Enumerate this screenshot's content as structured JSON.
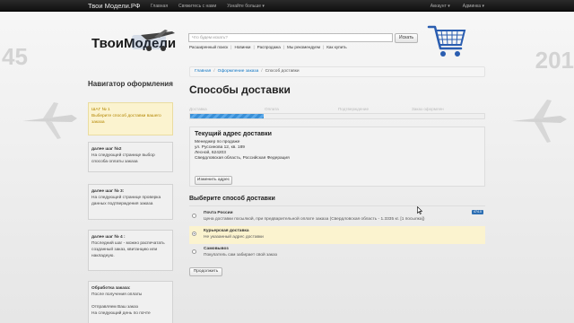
{
  "topbar": {
    "brand": "Твои Модели.РФ",
    "nav": [
      "Главная",
      "Свяжитесь с нами",
      "Узнайте больше ▾"
    ],
    "right": [
      "Аккаунт ▾",
      "Админка ▾"
    ]
  },
  "header": {
    "logo_text": "ТвоиМодели",
    "search_placeholder": "Что будем искать?",
    "search_button": "Искать",
    "quicklinks": [
      "Расширенный поиск",
      "Новинки",
      "Распродажа",
      "Мы рекомендуем",
      "Как купить"
    ]
  },
  "background": {
    "left_number": "45",
    "right_number": "201"
  },
  "sidebar": {
    "title": "Навигатор оформления",
    "steps": [
      {
        "head": "ШАГ № 1",
        "text": "Выберите способ доставки вашего заказа"
      },
      {
        "head": "далее шаг №2",
        "text": "На следующей странице выбор способа оплаты заказа"
      },
      {
        "head": "далее шаг № 3:",
        "text": "На следующей странице проверка данных подтверждения заказа"
      },
      {
        "head": "далее шаг № 4 :",
        "text": "Последний шаг - можно распечатать созданный заказ, квитанцию или накладную."
      },
      {
        "head": "Обработка заказа:",
        "text": "После получения оплаты",
        "text2": "Отправляем Ваш заказ",
        "text3": "На следующий день по почте"
      }
    ]
  },
  "breadcrumb": {
    "home": "Главная",
    "checkout": "Оформление заказа",
    "current": "Способ доставки"
  },
  "main": {
    "title": "Способы доставки",
    "progress": {
      "labels": [
        "Доставка",
        "Оплата",
        "Подтверждение",
        "Заказ оформлен"
      ],
      "fraction": 0.25
    },
    "address": {
      "title": "Текущий адрес доставки",
      "lines": [
        "Менеджер по продаже",
        "ул. Руссинова 12, кв. 189",
        "Лесной, 624203",
        "Свердловская область, Российская Федерация"
      ],
      "button": "Изменить адрес"
    },
    "shipping": {
      "title": "Выберите способ доставки",
      "options": [
        {
          "name": "Почта России",
          "desc": "Цена доставки посылкой, при предварительной оплате заказа  (Свердловская область - 1.3335 кг. [1 посылка])",
          "badge": "474.0",
          "selected": false
        },
        {
          "name": "Курьерская доставка",
          "desc": "Не указанный адрес доставки",
          "selected": true
        },
        {
          "name": "Самовывоз",
          "desc": "Покупатель сам забирает свой заказ",
          "selected": false
        }
      ]
    },
    "continue_button": "Продолжить"
  }
}
